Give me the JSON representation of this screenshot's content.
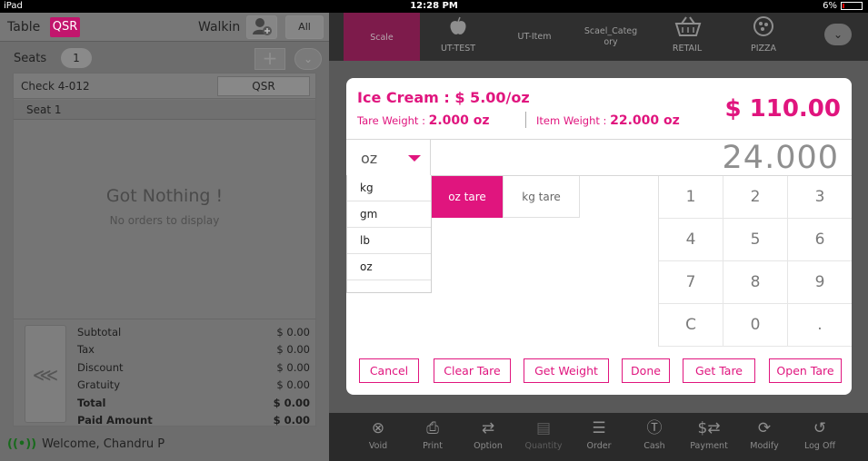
{
  "status": {
    "device": "iPad",
    "time": "12:28 PM",
    "battery": "6%"
  },
  "left": {
    "table_label": "Table",
    "table_badge": "QSR",
    "customer": "Walkin",
    "all_button": "All",
    "seats_label": "Seats",
    "seats_count": "1",
    "check_label": "Check  4-012",
    "check_type_button": "QSR",
    "seat_label": "Seat 1",
    "empty_title": "Got Nothing !",
    "empty_subtitle": "No orders to display",
    "totals": [
      {
        "label": "Subtotal",
        "value": "$ 0.00",
        "bold": false
      },
      {
        "label": "Tax",
        "value": "$ 0.00",
        "bold": false
      },
      {
        "label": "Discount",
        "value": "$ 0.00",
        "bold": false
      },
      {
        "label": "Gratuity",
        "value": "$ 0.00",
        "bold": false
      },
      {
        "label": "Total",
        "value": "$ 0.00",
        "bold": true
      },
      {
        "label": "Paid Amount",
        "value": "$ 0.00",
        "bold": true
      }
    ],
    "welcome": "Welcome, Chandru P"
  },
  "categories": [
    {
      "label": "Scale",
      "icon": "none",
      "active": true
    },
    {
      "label": "UT-TEST",
      "icon": "apple-icon",
      "active": false
    },
    {
      "label": "UT-Item",
      "icon": "none",
      "active": false
    },
    {
      "label": "Scael_Categ\nory",
      "icon": "none",
      "active": false
    },
    {
      "label": "RETAIL",
      "icon": "basket-icon",
      "active": false
    },
    {
      "label": "PIZZA",
      "icon": "pizza-icon",
      "active": false
    }
  ],
  "dialog": {
    "title": "Ice Cream : $ 5.00/oz",
    "tare_label": "Tare Weight : ",
    "tare_value": "2.000 oz",
    "item_label": "Item Weight : ",
    "item_value": "22.000 oz",
    "amount": "$ 110.00",
    "unit_selected": "oz",
    "weight": "24.000",
    "units": [
      "kg",
      "gm",
      "lb",
      "oz"
    ],
    "tare_options": [
      "oz tare",
      "kg tare"
    ],
    "keys": [
      "1",
      "2",
      "3",
      "4",
      "5",
      "6",
      "7",
      "8",
      "9",
      "C",
      "0",
      "."
    ],
    "actions": [
      "Cancel",
      "Clear Tare",
      "Get Weight",
      "Done",
      "Get Tare",
      "Open Tare"
    ]
  },
  "bottom_bar": [
    {
      "label": "Void",
      "icon": "void-icon",
      "enabled": true
    },
    {
      "label": "Print",
      "icon": "printer-icon",
      "enabled": true
    },
    {
      "label": "Option",
      "icon": "option-icon",
      "enabled": true
    },
    {
      "label": "Quantity",
      "icon": "quantity-icon",
      "enabled": false
    },
    {
      "label": "Order",
      "icon": "order-icon",
      "enabled": true
    },
    {
      "label": "Cash",
      "icon": "cash-icon",
      "enabled": true
    },
    {
      "label": "Payment",
      "icon": "payment-icon",
      "enabled": true
    },
    {
      "label": "Modify",
      "icon": "modify-icon",
      "enabled": true
    },
    {
      "label": "Log Off",
      "icon": "logoff-icon",
      "enabled": true
    }
  ],
  "colors": {
    "accent": "#e0157e",
    "active_category": "#7d1b4b"
  }
}
